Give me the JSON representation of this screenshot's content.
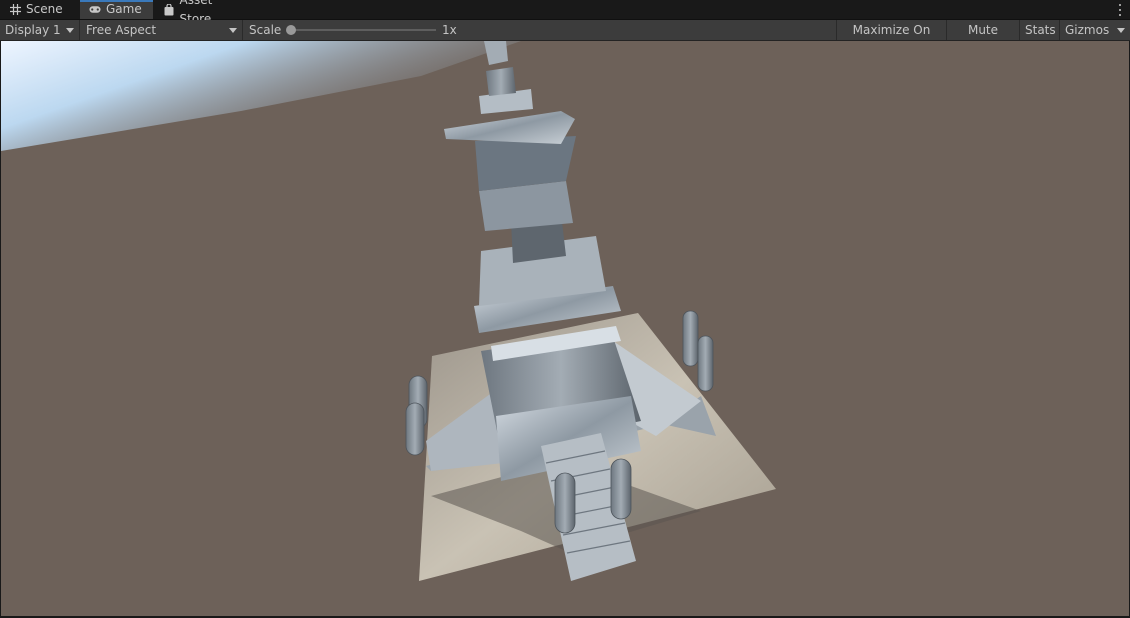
{
  "tabs": [
    {
      "label": "Scene",
      "icon": "grid-icon"
    },
    {
      "label": "Game",
      "icon": "gamepad-icon",
      "active": true
    },
    {
      "label": "Asset Store",
      "icon": "shopping-bag-icon"
    }
  ],
  "toolbar": {
    "display_value": "Display 1",
    "aspect_value": "Free Aspect",
    "scale_label": "Scale",
    "scale_value": "1x",
    "maximize_label": "Maximize On Play",
    "mute_label": "Mute Audio",
    "stats_label": "Stats",
    "gizmos_label": "Gizmos"
  },
  "colors": {
    "tab_accent": "#3a79bb",
    "ground": "#6d6159",
    "stone": "#b8c2cc",
    "base_plane": "#bcb4a6"
  }
}
